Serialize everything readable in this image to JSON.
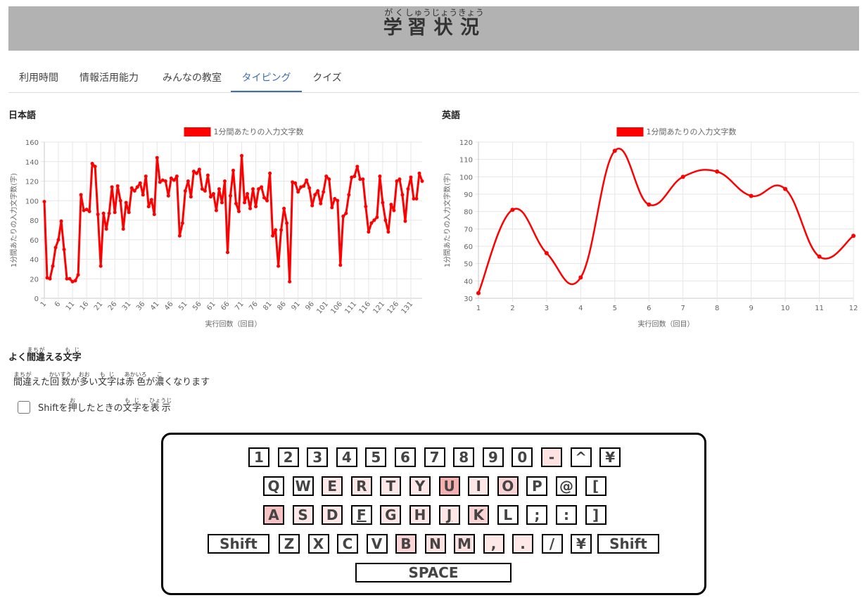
{
  "header": {
    "title_parts": [
      {
        "kanji": "学",
        "ruby": "がく"
      },
      {
        "kanji": "習",
        "ruby": "しゅう"
      },
      {
        "kanji": "状",
        "ruby": "じょう"
      },
      {
        "kanji": "況",
        "ruby": "きょう"
      }
    ]
  },
  "tabs": [
    {
      "label": "利用時間",
      "active": false
    },
    {
      "label": "情報活用能力",
      "active": false
    },
    {
      "label": "みんなの教室",
      "active": false
    },
    {
      "label": "タイピング",
      "active": true
    },
    {
      "label": "クイズ",
      "active": false
    }
  ],
  "colors": {
    "accent": "#3b6fb6",
    "series": "#ff0000",
    "header_bg": "#b2b2b2"
  },
  "charts": {
    "japanese_label": "日本語",
    "english_label": "英語"
  },
  "chart_data": [
    {
      "type": "line",
      "title": "",
      "legend": "1分間あたりの入力文字数",
      "legend_position": "top",
      "xlabel": "実行回数（回目）",
      "ylabel": "1分間あたりの入力文字数(字)",
      "ylim": [
        0,
        160
      ],
      "yticks": [
        0,
        20,
        40,
        60,
        80,
        100,
        120,
        140,
        160
      ],
      "xtick_labels": [
        "1",
        "6",
        "11",
        "16",
        "21",
        "26",
        "31",
        "36",
        "41",
        "46",
        "51",
        "56",
        "61",
        "66",
        "71",
        "76",
        "81",
        "86",
        "91",
        "96",
        "101",
        "106",
        "111",
        "116",
        "121",
        "126",
        "131"
      ],
      "grid": true,
      "smooth": false,
      "x": [
        1,
        2,
        3,
        4,
        5,
        6,
        7,
        8,
        9,
        10,
        11,
        12,
        13,
        14,
        15,
        16,
        17,
        18,
        19,
        20,
        21,
        22,
        23,
        24,
        25,
        26,
        27,
        28,
        29,
        30,
        31,
        32,
        33,
        34,
        35,
        36,
        37,
        38,
        39,
        40,
        41,
        42,
        43,
        44,
        45,
        46,
        47,
        48,
        49,
        50,
        51,
        52,
        53,
        54,
        55,
        56,
        57,
        58,
        59,
        60,
        61,
        62,
        63,
        64,
        65,
        66,
        67,
        68,
        69,
        70,
        71,
        72,
        73,
        74,
        75,
        76,
        77,
        78,
        79,
        80,
        81,
        82,
        83,
        84,
        85,
        86,
        87,
        88,
        89,
        90,
        91,
        92,
        93,
        94,
        95,
        96,
        97,
        98,
        99,
        100,
        101,
        102,
        103,
        104,
        105,
        106,
        107,
        108,
        109,
        110,
        111,
        112,
        113,
        114,
        115,
        116,
        117,
        118,
        119,
        120,
        121,
        122,
        123,
        124,
        125,
        126,
        127,
        128,
        129,
        130,
        131,
        132,
        133,
        134,
        135
      ],
      "series": [
        {
          "name": "1分間あたりの入力文字数",
          "values": [
            99,
            21,
            20,
            33,
            52,
            60,
            79,
            50,
            20,
            20,
            17,
            18,
            24,
            106,
            90,
            91,
            89,
            138,
            135,
            86,
            33,
            87,
            71,
            87,
            114,
            88,
            115,
            100,
            71,
            98,
            88,
            113,
            110,
            114,
            118,
            106,
            125,
            94,
            101,
            86,
            144,
            119,
            121,
            120,
            105,
            123,
            121,
            125,
            64,
            77,
            110,
            120,
            104,
            130,
            128,
            132,
            112,
            110,
            126,
            104,
            107,
            90,
            112,
            98,
            120,
            47,
            105,
            131,
            97,
            89,
            146,
            98,
            107,
            92,
            112,
            94,
            112,
            114,
            103,
            100,
            128,
            64,
            70,
            33,
            70,
            92,
            77,
            17,
            119,
            118,
            109,
            114,
            115,
            121,
            113,
            95,
            106,
            110,
            97,
            109,
            125,
            122,
            93,
            102,
            100,
            34,
            84,
            87,
            106,
            124,
            125,
            135,
            122,
            122,
            94,
            68,
            77,
            80,
            83,
            125,
            98,
            80,
            68,
            96,
            90,
            120,
            122,
            106,
            79,
            112,
            124,
            102,
            102,
            128,
            120
          ]
        }
      ]
    },
    {
      "type": "line",
      "title": "",
      "legend": "1分間あたりの入力文字数",
      "legend_position": "top",
      "xlabel": "実行回数（回目）",
      "ylabel": "1分間あたりの入力文字数(字)",
      "ylim": [
        30,
        120
      ],
      "yticks": [
        30,
        40,
        50,
        60,
        70,
        80,
        90,
        100,
        110,
        120
      ],
      "xtick_labels": [
        "1",
        "2",
        "3",
        "4",
        "5",
        "6",
        "7",
        "8",
        "9",
        "10",
        "11",
        "12"
      ],
      "grid": true,
      "smooth": true,
      "x": [
        1,
        2,
        3,
        4,
        5,
        6,
        7,
        8,
        9,
        10,
        11,
        12
      ],
      "series": [
        {
          "name": "1分間あたりの入力文字数",
          "values": [
            33,
            81,
            56,
            42,
            115,
            84,
            100,
            103,
            89,
            93,
            54,
            66
          ]
        }
      ]
    }
  ],
  "mistakes": {
    "title_parts": [
      {
        "text": "よく"
      },
      {
        "kanji": "間違",
        "ruby": "まちが"
      },
      {
        "text": "える"
      },
      {
        "kanji": "文字",
        "ruby": "もじ"
      }
    ],
    "desc_parts": [
      {
        "kanji": "間違",
        "ruby": "まちが"
      },
      {
        "text": "えた"
      },
      {
        "kanji": "回数",
        "ruby": "かいすう"
      },
      {
        "text": "が"
      },
      {
        "kanji": "多",
        "ruby": "おお"
      },
      {
        "text": "い"
      },
      {
        "kanji": "文字",
        "ruby": "もじ"
      },
      {
        "text": "は"
      },
      {
        "kanji": "赤色",
        "ruby": "あかいろ"
      },
      {
        "text": "が"
      },
      {
        "kanji": "濃",
        "ruby": "こ"
      },
      {
        "text": "くなります"
      }
    ],
    "shift_parts": [
      {
        "text": "Shiftを"
      },
      {
        "kanji": "押",
        "ruby": "お"
      },
      {
        "text": "したときの"
      },
      {
        "kanji": "文字",
        "ruby": "もじ"
      },
      {
        "text": "を"
      },
      {
        "kanji": "表示",
        "ruby": "ひょうじ"
      }
    ],
    "shift_checked": false
  },
  "keyboard": {
    "rows": [
      [
        {
          "label": "1",
          "color": "#ffffff"
        },
        {
          "label": "2",
          "color": "#ffffff"
        },
        {
          "label": "3",
          "color": "#ffffff"
        },
        {
          "label": "4",
          "color": "#ffffff"
        },
        {
          "label": "5",
          "color": "#ffffff"
        },
        {
          "label": "6",
          "color": "#ffffff"
        },
        {
          "label": "7",
          "color": "#ffffff"
        },
        {
          "label": "8",
          "color": "#ffffff"
        },
        {
          "label": "9",
          "color": "#ffffff"
        },
        {
          "label": "0",
          "color": "#ffffff"
        },
        {
          "label": "-",
          "color": "#fde2e2"
        },
        {
          "label": "^",
          "color": "#ffffff"
        },
        {
          "label": "¥",
          "color": "#ffffff"
        }
      ],
      [
        {
          "label": "Q",
          "color": "#ffffff"
        },
        {
          "label": "W",
          "color": "#ffffff"
        },
        {
          "label": "E",
          "color": "#fde7e7"
        },
        {
          "label": "R",
          "color": "#fde7e7"
        },
        {
          "label": "T",
          "color": "#fde7e7"
        },
        {
          "label": "Y",
          "color": "#fde7e7"
        },
        {
          "label": "U",
          "color": "#f6b0b0"
        },
        {
          "label": "I",
          "color": "#fde7e7"
        },
        {
          "label": "O",
          "color": "#fad4d4"
        },
        {
          "label": "P",
          "color": "#ffffff"
        },
        {
          "label": "@",
          "color": "#ffffff"
        },
        {
          "label": "[",
          "color": "#ffffff"
        }
      ],
      [
        {
          "label": "A",
          "color": "#f8c2c2"
        },
        {
          "label": "S",
          "color": "#fde7e7"
        },
        {
          "label": "D",
          "color": "#fde7e7"
        },
        {
          "label": "F",
          "color": "#ffffff",
          "underline": true
        },
        {
          "label": "G",
          "color": "#fde7e7"
        },
        {
          "label": "H",
          "color": "#fde7e7"
        },
        {
          "label": "J",
          "color": "#fde7e7",
          "underline": true
        },
        {
          "label": "K",
          "color": "#fad4d4"
        },
        {
          "label": "L",
          "color": "#ffffff"
        },
        {
          "label": ";",
          "color": "#ffffff"
        },
        {
          "label": ":",
          "color": "#ffffff"
        },
        {
          "label": "]",
          "color": "#ffffff"
        }
      ],
      [
        {
          "label": "Shift",
          "color": "#ffffff",
          "wide": "shift"
        },
        {
          "label": "Z",
          "color": "#ffffff"
        },
        {
          "label": "X",
          "color": "#ffffff"
        },
        {
          "label": "C",
          "color": "#ffffff"
        },
        {
          "label": "V",
          "color": "#ffffff"
        },
        {
          "label": "B",
          "color": "#fad4d4"
        },
        {
          "label": "N",
          "color": "#fde2e2"
        },
        {
          "label": "M",
          "color": "#fde2e2"
        },
        {
          "label": ",",
          "color": "#fde7e7"
        },
        {
          "label": ".",
          "color": "#fde7e7"
        },
        {
          "label": "/",
          "color": "#ffffff"
        },
        {
          "label": "¥",
          "color": "#ffffff"
        },
        {
          "label": "Shift",
          "color": "#ffffff",
          "wide": "shift"
        }
      ],
      [
        {
          "label": "SPACE",
          "color": "#ffffff",
          "wide": "space"
        }
      ]
    ]
  }
}
